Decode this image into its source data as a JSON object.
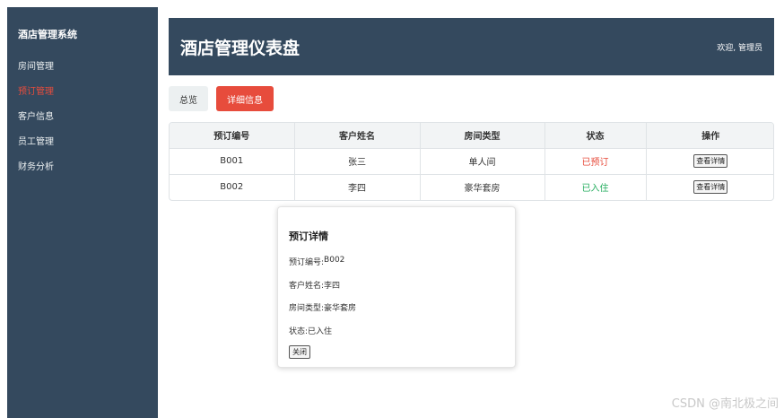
{
  "sidebar": {
    "title": "酒店管理系统",
    "items": [
      {
        "label": "房间管理"
      },
      {
        "label": "预订管理"
      },
      {
        "label": "客户信息"
      },
      {
        "label": "员工管理"
      },
      {
        "label": "财务分析"
      }
    ]
  },
  "header": {
    "title": "酒店管理仪表盘",
    "welcome": "欢迎, 管理员"
  },
  "tabs": {
    "overview": "总览",
    "detail": "详细信息"
  },
  "table": {
    "headers": [
      "预订编号",
      "客户姓名",
      "房间类型",
      "状态",
      "操作"
    ],
    "rows": [
      {
        "id": "B001",
        "name": "张三",
        "room": "单人间",
        "status": "已预订",
        "action": "查看详情"
      },
      {
        "id": "B002",
        "name": "李四",
        "room": "豪华套房",
        "status": "已入住",
        "action": "查看详情"
      }
    ]
  },
  "modal": {
    "title": "预订详情",
    "id_label": "预订编号:",
    "id_value": "B002",
    "name_label": "客户姓名:",
    "name_value": "李四",
    "room_label": "房间类型:",
    "room_value": "豪华套房",
    "status_label": "状态:",
    "status_value": "已入住",
    "close": "关闭"
  },
  "watermark": "CSDN @南北极之间",
  "colors": {
    "sidebar_bg": "#34495e",
    "accent": "#e74c3c",
    "status_booked": "#e74c3c",
    "status_checkin": "#27ae60"
  }
}
